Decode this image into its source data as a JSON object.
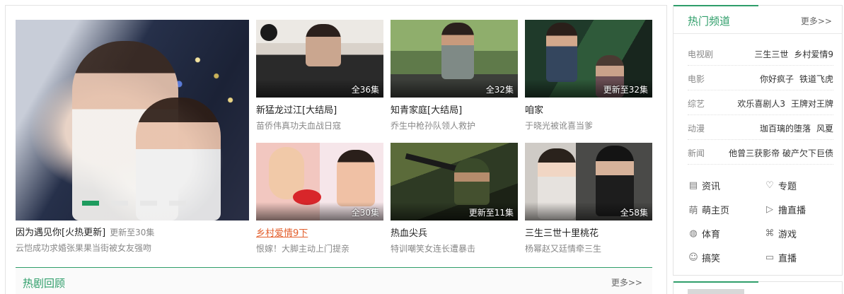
{
  "hero": {
    "title": "因为遇见你[火热更新]",
    "episodes": "更新至30集",
    "desc": "云恺成功求婚张果果当街被女友强吻"
  },
  "cards": [
    {
      "title": "新猛龙过江[大结局]",
      "desc": "苗侨伟真功夫血战日寇",
      "badge": "全36集"
    },
    {
      "title": "知青家庭[大结局]",
      "desc": "乔生中枪孙队领人救护",
      "badge": "全32集"
    },
    {
      "title": "咱家",
      "desc": "于晓光被讹喜当爹",
      "badge": "更新至32集"
    },
    {
      "title": "乡村爱情9下",
      "desc": "恨嫁！大脚主动上门提亲",
      "badge": "全30集"
    },
    {
      "title": "热血尖兵",
      "desc": "特训嘲笑女连长遭暴击",
      "badge": "更新至11集"
    },
    {
      "title": "三生三世十里桃花",
      "desc": "杨幂赵又廷情牵三生",
      "badge": "全58集"
    }
  ],
  "section": {
    "title": "热剧回顾",
    "more": "更多>>"
  },
  "side": {
    "title": "热门频道",
    "more": "更多>>",
    "rows": [
      {
        "cat": "电视剧",
        "links": [
          "三生三世",
          "乡村爱情9"
        ]
      },
      {
        "cat": "电影",
        "links": [
          "你好疯子",
          "铁道飞虎"
        ]
      },
      {
        "cat": "综艺",
        "links": [
          "欢乐喜剧人3",
          "王牌对王牌"
        ]
      },
      {
        "cat": "动漫",
        "links": [
          "珈百璃的堕落",
          "风夏"
        ]
      },
      {
        "cat": "新闻",
        "links": [
          "他曾三获影帝 破产欠下巨债"
        ]
      }
    ],
    "quick": [
      {
        "label": "资讯",
        "icon": "news-icon"
      },
      {
        "label": "专题",
        "icon": "heart-icon"
      },
      {
        "label": "萌主页",
        "icon": "cute-icon"
      },
      {
        "label": "撸直播",
        "icon": "play-icon"
      },
      {
        "label": "体育",
        "icon": "ball-icon"
      },
      {
        "label": "游戏",
        "icon": "gamepad-icon"
      },
      {
        "label": "搞笑",
        "icon": "smile-icon"
      },
      {
        "label": "直播",
        "icon": "tv-icon"
      }
    ]
  },
  "colors": {
    "accent": "#2f9e6a",
    "highlight": "#e35f2d",
    "active_dot": "#1e9b5e"
  }
}
